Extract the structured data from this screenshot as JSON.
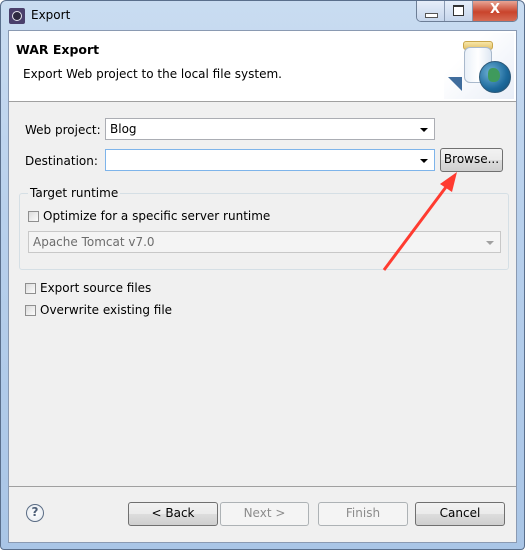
{
  "window": {
    "title": "Export",
    "icon": "eclipse-gear-icon",
    "controls": {
      "minimize": "minimize-icon",
      "maximize": "maximize-icon",
      "close": "close-icon",
      "close_glyph": "X"
    }
  },
  "header": {
    "title": "WAR Export",
    "description": "Export Web project to the local file system.",
    "image": "war-jar-globe-icon"
  },
  "form": {
    "web_project": {
      "label": "Web project:",
      "value": "Blog"
    },
    "destination": {
      "label": "Destination:",
      "value": "",
      "browse_label": "Browse..."
    },
    "target_runtime": {
      "group_label": "Target runtime",
      "optimize": {
        "label": "Optimize for a specific server runtime",
        "checked": false
      },
      "runtime": {
        "value": "Apache Tomcat v7.0",
        "enabled": false
      }
    },
    "export_source": {
      "label": "Export source files",
      "checked": false
    },
    "overwrite": {
      "label": "Overwrite existing file",
      "checked": false
    }
  },
  "footer": {
    "help_glyph": "?",
    "back_label": "< Back",
    "next_label": "Next >",
    "finish_label": "Finish",
    "cancel_label": "Cancel"
  },
  "annotation": {
    "type": "red-arrow",
    "points_to": "Browse...",
    "color": "#ff3b30"
  }
}
